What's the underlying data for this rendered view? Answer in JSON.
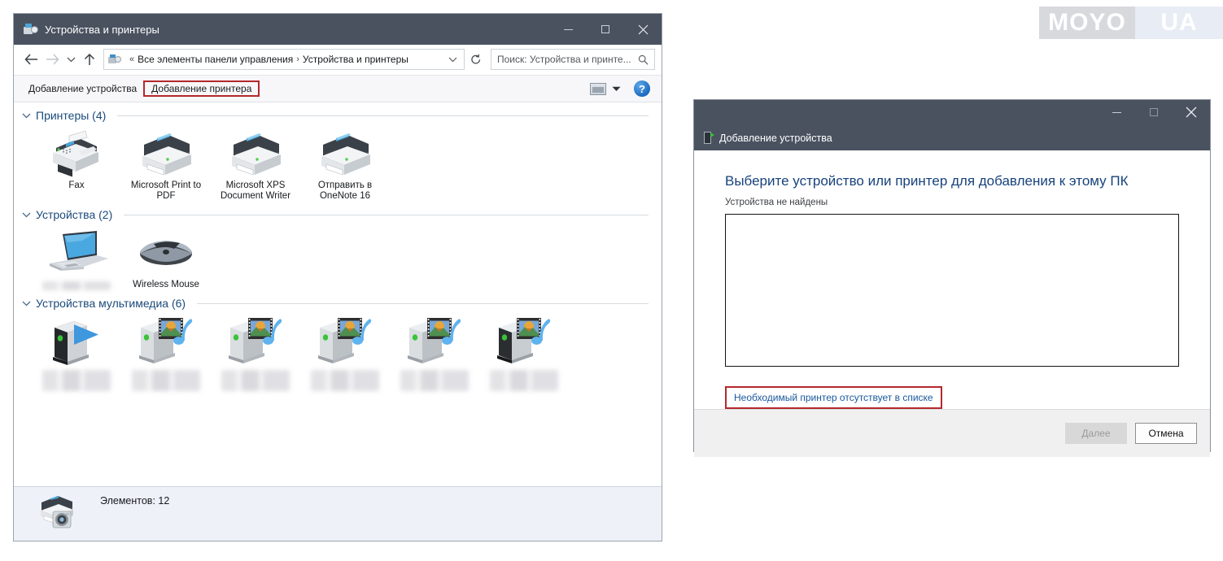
{
  "watermark": {
    "left_text": "MOYO",
    "right_text": "UA"
  },
  "explorer": {
    "title": "Устройства и принтеры",
    "title_icon": "devices-and-printers-icon",
    "window_controls": {
      "minimize": "minimize-icon",
      "maximize": "maximize-icon",
      "close": "close-icon"
    },
    "navigation": {
      "back": "back-arrow-icon",
      "forward": "forward-arrow-icon",
      "recent": "chevron-down-icon",
      "up": "up-arrow-icon"
    },
    "breadcrumb": {
      "overflow": "«",
      "items": [
        "Все элементы панели управления",
        "Устройства и принтеры"
      ],
      "separator": "›",
      "dropdown": "chevron-down-icon",
      "refresh": "refresh-icon"
    },
    "search": {
      "placeholder": "Поиск: Устройства и принте...",
      "icon": "search-icon"
    },
    "command_bar": {
      "add_device": "Добавление устройства",
      "add_printer": "Добавление принтера",
      "view_icon": "view-layout-icon",
      "view_dropdown": "chevron-down-icon",
      "help": "?"
    },
    "groups": [
      {
        "title": "Принтеры (4)",
        "chevron": "chevron-down-icon",
        "items": [
          {
            "label": "Fax",
            "icon": "fax-printer-icon",
            "blurred": false
          },
          {
            "label": "Microsoft Print to PDF",
            "icon": "printer-icon",
            "blurred": false
          },
          {
            "label": "Microsoft XPS Document Writer",
            "icon": "printer-icon",
            "blurred": false
          },
          {
            "label": "Отправить в OneNote 16",
            "icon": "printer-icon",
            "blurred": false
          }
        ]
      },
      {
        "title": "Устройства (2)",
        "chevron": "chevron-down-icon",
        "items": [
          {
            "label": "",
            "icon": "laptop-icon",
            "blurred": true
          },
          {
            "label": "Wireless Mouse",
            "icon": "mouse-icon",
            "blurred": false
          }
        ]
      },
      {
        "title": "Устройства мультимедиа (6)",
        "chevron": "chevron-down-icon",
        "items": [
          {
            "label": "",
            "icon": "media-player-device-icon",
            "blurred": true
          },
          {
            "label": "",
            "icon": "media-server-device-icon",
            "blurred": true
          },
          {
            "label": "",
            "icon": "media-server-device-icon",
            "blurred": true
          },
          {
            "label": "",
            "icon": "media-server-device-icon",
            "blurred": true
          },
          {
            "label": "",
            "icon": "media-server-device-icon",
            "blurred": true
          },
          {
            "label": "",
            "icon": "media-server-device-icon",
            "blurred": true
          }
        ]
      }
    ],
    "details_pane": {
      "icon": "printer-camera-icon",
      "status": "Элементов: 12"
    }
  },
  "dialog": {
    "title": "Добавление устройства",
    "title_icon": "add-device-icon",
    "window_controls": {
      "minimize": "minimize-icon",
      "maximize": "maximize-icon",
      "close": "close-icon"
    },
    "heading": "Выберите устройство или принтер для добавления к этому ПК",
    "subtext": "Устройства не найдены",
    "list_items": [],
    "link": "Необходимый принтер отсутствует в списке",
    "buttons": {
      "next_prefix": "Д",
      "next_rest": "алее",
      "cancel": "Отмена"
    }
  },
  "colors": {
    "titlebar": "#4a5260",
    "accent_red": "#b4282c",
    "link_blue": "#19589c",
    "heading_blue": "#17427c",
    "group_blue": "#1a4a7a",
    "details_bg": "#eef1f8"
  }
}
